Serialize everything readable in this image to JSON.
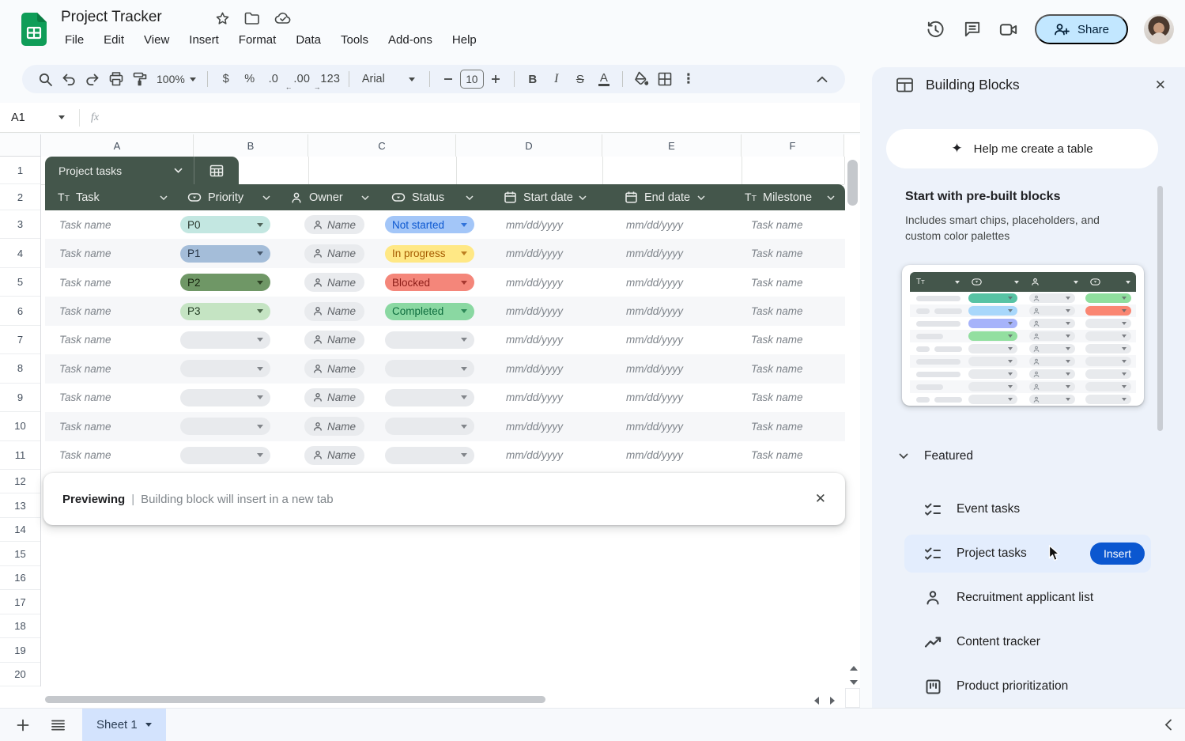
{
  "app": {
    "title": "Project Tracker",
    "menus": [
      "File",
      "Edit",
      "View",
      "Insert",
      "Format",
      "Data",
      "Tools",
      "Add-ons",
      "Help"
    ],
    "actions": {
      "share": "Share"
    }
  },
  "toolbar": {
    "zoom": "100%",
    "currency": "$",
    "percent": "%",
    "decrease_decimal": ".0",
    "increase_decimal": ".00",
    "more_formats": "123",
    "font": "Arial",
    "font_size": "10",
    "bold": "B",
    "italic": "I",
    "strikethrough": "S",
    "text_color": "A"
  },
  "formula_bar": {
    "cell_ref": "A1",
    "fx_label": "fx"
  },
  "grid": {
    "columns": [
      "A",
      "B",
      "C",
      "D",
      "E",
      "F"
    ],
    "rows": [
      "1",
      "2",
      "3",
      "4",
      "5",
      "6",
      "7",
      "8",
      "9",
      "10",
      "11",
      "12",
      "13",
      "14",
      "15",
      "16",
      "17",
      "18",
      "19",
      "20"
    ]
  },
  "table": {
    "tab_label": "Project tasks",
    "headers": [
      {
        "label": "Task",
        "icon": "text-column-icon"
      },
      {
        "label": "Priority",
        "icon": "dropdown-column-icon"
      },
      {
        "label": "Owner",
        "icon": "person-column-icon"
      },
      {
        "label": "Status",
        "icon": "dropdown-column-icon"
      },
      {
        "label": "Start date",
        "icon": "date-column-icon"
      },
      {
        "label": "End date",
        "icon": "date-column-icon"
      },
      {
        "label": "Milestone",
        "icon": "text-column-icon"
      }
    ],
    "rows": [
      {
        "task": "Task name",
        "priority": "P0",
        "priority_style": "p0",
        "owner": "Name",
        "status": "Not started",
        "status_style": "notstarted",
        "start": "mm/dd/yyyy",
        "end": "mm/dd/yyyy",
        "milestone": "Task name"
      },
      {
        "task": "Task name",
        "priority": "P1",
        "priority_style": "p1",
        "owner": "Name",
        "status": "In progress",
        "status_style": "inprogress",
        "start": "mm/dd/yyyy",
        "end": "mm/dd/yyyy",
        "milestone": "Task name"
      },
      {
        "task": "Task name",
        "priority": "P2",
        "priority_style": "p2",
        "owner": "Name",
        "status": "Blocked",
        "status_style": "blocked",
        "start": "mm/dd/yyyy",
        "end": "mm/dd/yyyy",
        "milestone": "Task name"
      },
      {
        "task": "Task name",
        "priority": "P3",
        "priority_style": "p3",
        "owner": "Name",
        "status": "Completed",
        "status_style": "completed",
        "start": "mm/dd/yyyy",
        "end": "mm/dd/yyyy",
        "milestone": "Task name"
      },
      {
        "task": "Task name",
        "priority": "",
        "priority_style": "empty",
        "owner": "Name",
        "status": "",
        "status_style": "empty",
        "start": "mm/dd/yyyy",
        "end": "mm/dd/yyyy",
        "milestone": "Task name"
      },
      {
        "task": "Task name",
        "priority": "",
        "priority_style": "empty",
        "owner": "Name",
        "status": "",
        "status_style": "empty",
        "start": "mm/dd/yyyy",
        "end": "mm/dd/yyyy",
        "milestone": "Task name"
      },
      {
        "task": "Task name",
        "priority": "",
        "priority_style": "empty",
        "owner": "Name",
        "status": "",
        "status_style": "empty",
        "start": "mm/dd/yyyy",
        "end": "mm/dd/yyyy",
        "milestone": "Task name"
      },
      {
        "task": "Task name",
        "priority": "",
        "priority_style": "empty",
        "owner": "Name",
        "status": "",
        "status_style": "empty",
        "start": "mm/dd/yyyy",
        "end": "mm/dd/yyyy",
        "milestone": "Task name"
      },
      {
        "task": "Task name",
        "priority": "",
        "priority_style": "empty",
        "owner": "Name",
        "status": "",
        "status_style": "empty",
        "start": "mm/dd/yyyy",
        "end": "mm/dd/yyyy",
        "milestone": "Task name"
      }
    ]
  },
  "preview_banner": {
    "title": "Previewing",
    "separator": "|",
    "message": "Building block will insert in a new tab"
  },
  "sheet_bar": {
    "active_sheet": "Sheet 1"
  },
  "sidebar": {
    "title": "Building Blocks",
    "help_button_label": "Help me create a table",
    "section_title": "Start with pre-built blocks",
    "section_subtitle": "Includes smart chips, placeholders, and custom color palettes",
    "featured_label": "Featured",
    "items": [
      {
        "label": "Event tasks",
        "icon": "checklist-icon",
        "active": false
      },
      {
        "label": "Project tasks",
        "icon": "checklist-icon",
        "active": true,
        "action_label": "Insert"
      },
      {
        "label": "Recruitment applicant list",
        "icon": "person-icon",
        "active": false
      },
      {
        "label": "Content tracker",
        "icon": "trend-icon",
        "active": false
      },
      {
        "label": "Product prioritization",
        "icon": "kanban-icon",
        "active": false
      }
    ],
    "mini_table_rows": [
      {
        "bars": "long",
        "c2": "teal",
        "c4": "green"
      },
      {
        "bars": "two",
        "c2": "blue",
        "c4": "salmon"
      },
      {
        "bars": "long",
        "c2": "periwinkle",
        "c4": "gray"
      },
      {
        "bars": "short",
        "c2": "green",
        "c4": "gray"
      },
      {
        "bars": "two",
        "c2": "gray",
        "c4": "gray"
      },
      {
        "bars": "long",
        "c2": "gray",
        "c4": "gray"
      },
      {
        "bars": "long",
        "c2": "gray",
        "c4": "gray"
      },
      {
        "bars": "short",
        "c2": "gray",
        "c4": "gray"
      },
      {
        "bars": "two",
        "c2": "gray",
        "c4": "gray"
      }
    ]
  },
  "colors": {
    "accent_blue": "#0b57d0",
    "table_green": "#44564b",
    "logo_green": "#0f9d58",
    "share_bg": "#c2e7ff",
    "sheet_tab_bg": "#d3e3fd",
    "sidebar_bg": "#edf2fa",
    "active_item_bg": "#e3edfd",
    "priority_p0": "#c3e7e1",
    "priority_p1": "#a4bdd9",
    "priority_p2": "#6f9766",
    "priority_p3": "#c5e4c3",
    "status_not_started_bg": "#a3c6f8",
    "status_not_started_text": "#0b57d0",
    "status_in_progress_bg": "#ffe885",
    "status_in_progress_text": "#a55b00",
    "status_blocked_bg": "#f4867a",
    "status_blocked_text": "#8c1d18",
    "status_completed_bg": "#8ad8a2",
    "status_completed_text": "#0e6d3e",
    "chip_gray": "#e9ebee"
  }
}
